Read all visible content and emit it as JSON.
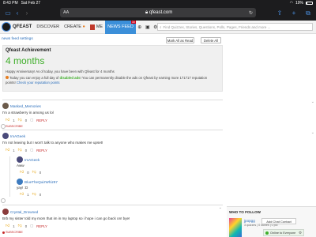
{
  "status_bar": {
    "time": "8:43 PM",
    "date": "Sat Feb 27",
    "wifi_icon": "wifi-icon",
    "battery": "19%",
    "battery_level": 0.19
  },
  "safari": {
    "text_size": "AA",
    "url": "qfeast.com",
    "lock_icon": "lock-icon",
    "reload_icon": "reload-icon"
  },
  "nav": {
    "brand": "QFEAST",
    "links": [
      "DISCOVER",
      "CREATE",
      "ME",
      "NEWS FEED"
    ],
    "news_feed_badge": "30",
    "search_placeholder": "Find Quizzes, Stories, Questions, Polls, Pages, Friends and more ..."
  },
  "settings_row": {
    "link": "news feed settings",
    "mark_all": "Mark All as Read",
    "delete_all": "Delete All"
  },
  "achievement": {
    "title": "Qfeast Achievement",
    "duration": "4 months",
    "line1": "Happy Anniversary! As of today, you have been with Qfeast for 4 months",
    "line2_pre": "Today you can enjoy a full day of ",
    "line2_hl": "disabled ads",
    "line2_post": "! You can permanently disable the ads on Qfeast by earning more 171717 reputation",
    "line3_pre": "points! ",
    "line3_link": "Check your reputation points"
  },
  "feed": [
    {
      "user": "Masked_Memories",
      "text": "I'm a strawberry in among us lol",
      "likes": "1",
      "dislikes": "0",
      "reply": "REPLY",
      "subscribe": "SUBSCRIBE"
    },
    {
      "user": "ImAGeek",
      "text": "I'm not leaving but I won't talk to anyone who makes me upset!",
      "likes": "1",
      "dislikes": "0",
      "reply": "REPLY",
      "subscribe": "SUBSCRIBE"
    },
    {
      "user": "ImAGeek",
      "text": "Aww",
      "likes": "0",
      "dislikes": "0",
      "reply": "",
      "subscribe": ""
    },
    {
      "user": "BlueTheQuizWhiz97",
      "text": "yay! :D",
      "likes": "1",
      "dislikes": "0",
      "reply": "",
      "subscribe": ""
    },
    {
      "user": "Crystal_Drowned",
      "text": "Brb my sister told my mom that im in my laptop so i hope i can go back on! bye!",
      "likes": "1",
      "dislikes": "0",
      "reply": "REPLY",
      "subscribe": "SUBSCRIBE"
    }
  ],
  "sidebar": {
    "who_title": "WHO TO FOLLOW",
    "who_name": "jpopgg",
    "who_stats": "3 quizzes | 0 stories | 0 pol",
    "chat_contact": "Add Chat Contact",
    "online": "Online to Everyone"
  }
}
